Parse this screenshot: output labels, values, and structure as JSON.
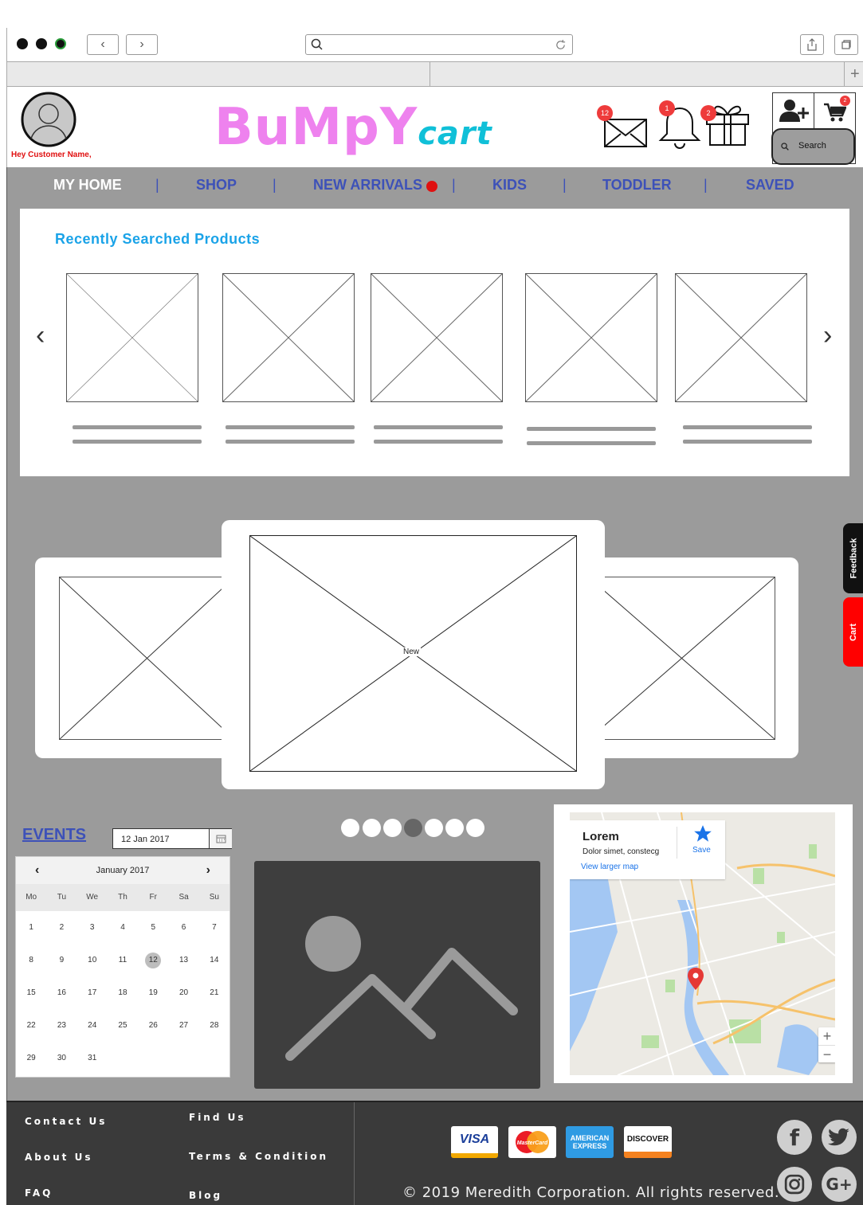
{
  "greeting": "Hey Customer Name,",
  "brand": {
    "main": "BuMpY",
    "suffix": "cart"
  },
  "header_badges": {
    "mail": "12",
    "bell": "1",
    "gift": "2",
    "cart": "2"
  },
  "search": {
    "label": "Search"
  },
  "nav": [
    "MY HOME",
    "SHOP",
    "NEW ARRIVALS",
    "KIDS",
    "TODDLER",
    "SAVED"
  ],
  "recent": {
    "title": "Recently Searched Products"
  },
  "carousel": {
    "center_label": "New"
  },
  "side_tabs": {
    "feedback": "Feedback",
    "cart": "Cart"
  },
  "events": {
    "title": "EVENTS",
    "date_value": "12 Jan 2017",
    "month": "January 2017",
    "prev": "‹",
    "next": "›",
    "weekdays": [
      "Mo",
      "Tu",
      "We",
      "Th",
      "Fr",
      "Sa",
      "Su"
    ],
    "days": [
      "1",
      "2",
      "3",
      "4",
      "5",
      "6",
      "7",
      "8",
      "9",
      "10",
      "11",
      "12",
      "13",
      "14",
      "15",
      "16",
      "17",
      "18",
      "19",
      "20",
      "21",
      "22",
      "23",
      "24",
      "25",
      "26",
      "27",
      "28",
      "29",
      "30",
      "31"
    ],
    "selected": "12"
  },
  "map": {
    "title": "Lorem",
    "subtitle": "Dolor simet, constecg",
    "link": "View larger map",
    "save": "Save",
    "zoom_in": "+",
    "zoom_out": "−"
  },
  "footer": {
    "col1": [
      "Contact Us",
      "About Us",
      "FAQ"
    ],
    "col2": [
      "Find Us",
      "Terms & Condition",
      "Blog"
    ],
    "copyright": "© 2019 Meredith Corporation. All rights reserved.",
    "payments": [
      "VISA",
      "MasterCard",
      "AMERICAN EXPRESS",
      "DISCOVER"
    ],
    "social": [
      "f",
      "t",
      "ig",
      "G+"
    ]
  },
  "colors": {
    "brand_pink": "#ee82ee",
    "brand_cyan": "#10c0d8",
    "nav_blue": "#3d51b8",
    "badge_red": "#ee3b3b",
    "title_blue": "#1aa3e8"
  }
}
